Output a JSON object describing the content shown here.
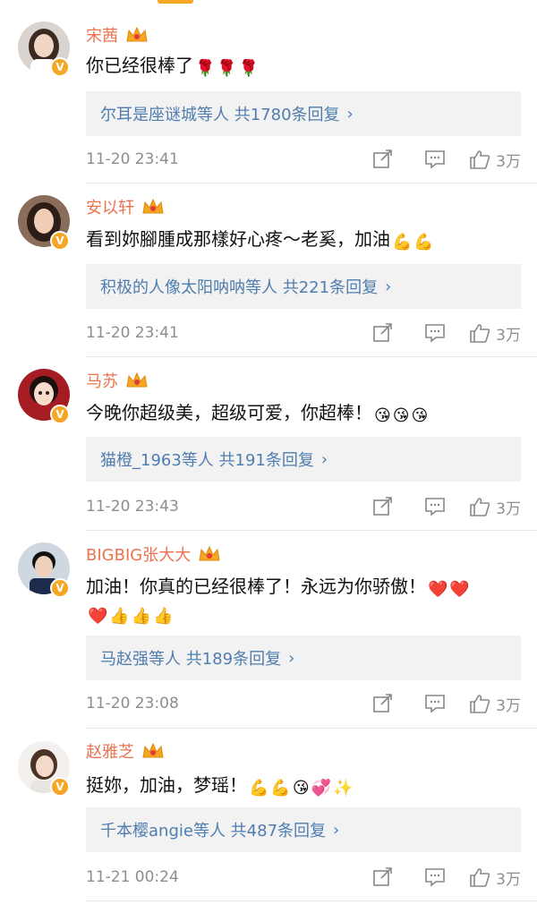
{
  "comments": [
    {
      "username": "宋茜",
      "text": "你已经很棒了",
      "emojis": [
        "🌹",
        "🌹",
        "🌹"
      ],
      "reply_summary": "尔耳是座谜城等人 共1780条回复",
      "time": "11-20 23:41",
      "likes": "3万",
      "avatar_colors": {
        "bg": "#d9d4cf",
        "face": "#f1d6c4",
        "hair": "#3a2a22"
      }
    },
    {
      "username": "安以轩",
      "text": "看到妳腳腫成那樣好心疼～老奚，加油",
      "emojis": [
        "💪",
        "💪"
      ],
      "reply_summary": "积极的人像太阳呐呐等人 共221条回复",
      "time": "11-20 23:41",
      "likes": "3万",
      "avatar_colors": {
        "bg": "#8a6c5a",
        "face": "#f0cdb6",
        "hair": "#2c1d16"
      }
    },
    {
      "username": "马苏",
      "text": "今晚你超级美，超级可爱，你超棒！",
      "emojis": [
        "😘",
        "😘",
        "😘"
      ],
      "reply_summary": "猫橙_1963等人 共191条回复",
      "time": "11-20 23:43",
      "likes": "3万",
      "avatar_colors": {
        "bg": "#a51d22",
        "face": "#f7dccb",
        "hair": "#1c1010"
      }
    },
    {
      "username": "BIGBIG张大大",
      "text": "加油！你真的已经很棒了！永远为你骄傲！",
      "emojis": [
        "❤️",
        "❤️"
      ],
      "text2_emojis": [
        "❤️",
        "👍",
        "👍",
        "👍"
      ],
      "reply_summary": "马赵强等人 共189条回复",
      "time": "11-20 23:08",
      "likes": "3万",
      "avatar_colors": {
        "bg": "#cfd8e0",
        "face": "#eed0bc",
        "hair": "#111111"
      }
    },
    {
      "username": "赵雅芝",
      "text": "挺妳，加油，梦瑶！",
      "emojis": [
        "💪",
        "💪",
        "😘",
        "💞",
        "✨"
      ],
      "reply_summary": "千本樱angie等人 共487条回复",
      "time": "11-21 00:24",
      "likes": "3万",
      "avatar_colors": {
        "bg": "#f3f0ee",
        "face": "#f4d9c8",
        "hair": "#4b3326"
      }
    }
  ],
  "ui": {
    "verified_badge": "V",
    "reply_chevron": "›",
    "share_icon": "share-icon",
    "comment_icon": "comment-icon",
    "like_icon": "thumbs-up-icon"
  },
  "colors": {
    "username": "#eb7350",
    "reply_link": "#507daf",
    "reply_bg": "#f2f2f2",
    "meta_gray": "#8e8e8e",
    "badge": "#f5a623"
  }
}
